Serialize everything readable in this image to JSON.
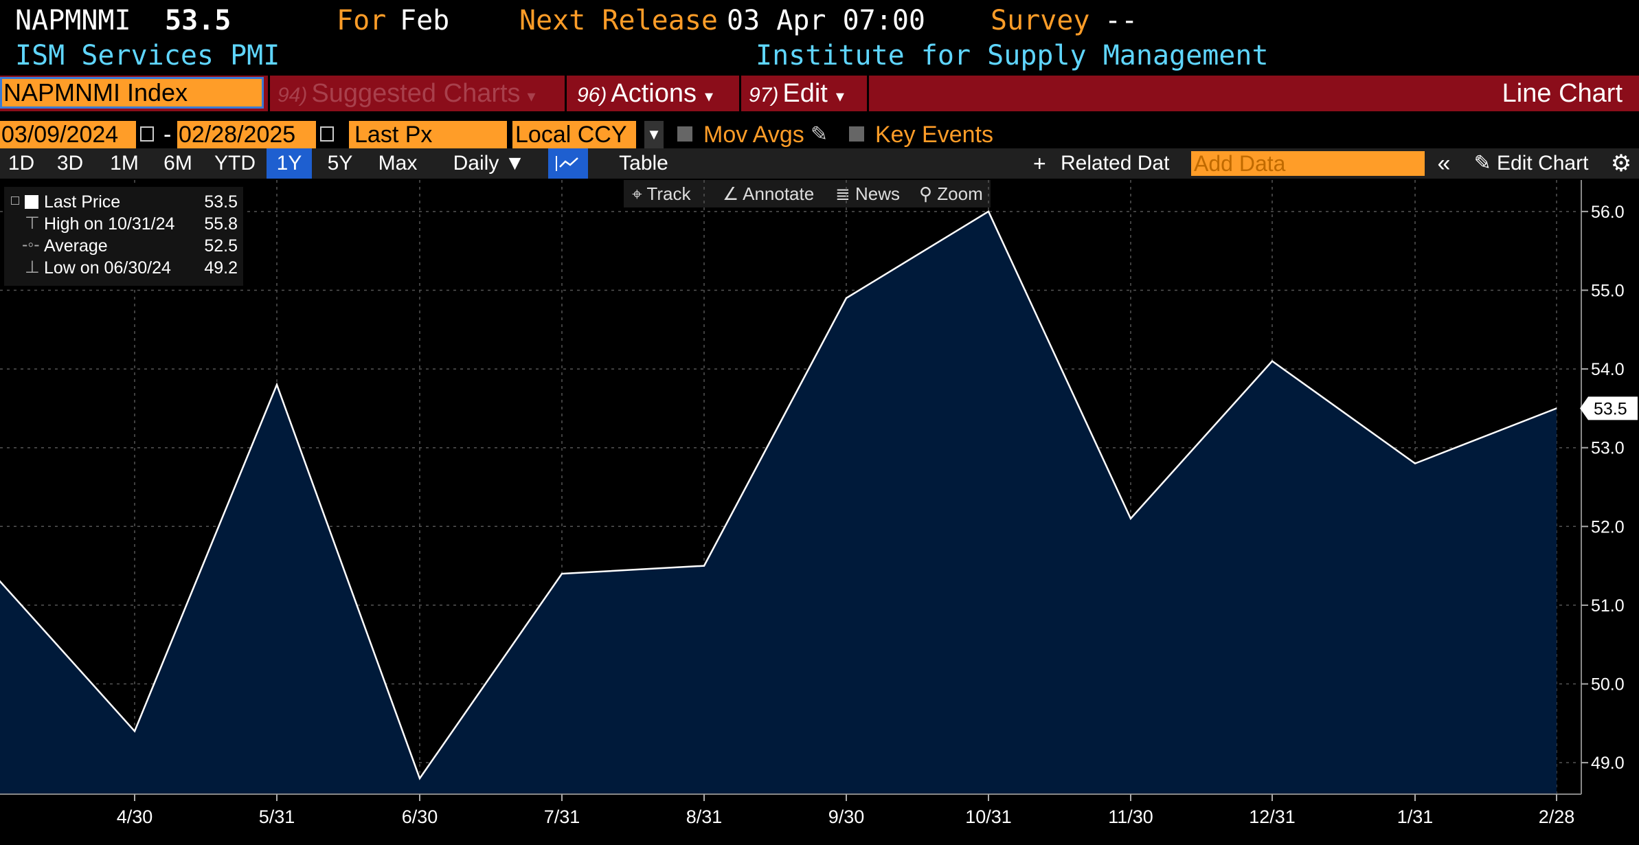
{
  "header": {
    "ticker": "NAPMNMI",
    "price": "53.5",
    "for_label": "For",
    "for_value": "Feb",
    "next_release_label": "Next Release",
    "next_release_value": "03 Apr 07:00",
    "survey_label": "Survey",
    "survey_value": "--",
    "name": "ISM Services PMI",
    "source": "Institute for Supply Management"
  },
  "toolbar": {
    "security": "NAPMNMI Index",
    "suggested_num": "94)",
    "suggested_label": "Suggested Charts",
    "actions_num": "96)",
    "actions_label": "Actions",
    "edit_num": "97)",
    "edit_label": "Edit",
    "chart_type": "Line Chart"
  },
  "controls": {
    "start_date": "03/09/2024",
    "dash": "-",
    "end_date": "02/28/2025",
    "field": "Last Px",
    "currency": "Local CCY",
    "mov_avgs": "Mov Avgs",
    "key_events": "Key Events"
  },
  "tabs": {
    "items": [
      "1D",
      "3D",
      "1M",
      "6M",
      "YTD",
      "1Y",
      "5Y",
      "Max"
    ],
    "active": "1Y",
    "frequency": "Daily ▼",
    "table": "Table",
    "related": "Related Dat",
    "add_data_placeholder": "Add Data",
    "edit_chart": "Edit Chart"
  },
  "tools": {
    "track": "Track",
    "annotate": "Annotate",
    "news": "News",
    "zoom": "Zoom"
  },
  "legend": {
    "last_label": "Last Price",
    "last_value": "53.5",
    "high_label": "High on 10/31/24",
    "high_value": "55.8",
    "avg_label": "Average",
    "avg_value": "52.5",
    "low_label": "Low on 06/30/24",
    "low_value": "49.2"
  },
  "chart_data": {
    "type": "area",
    "x": [
      "3/31",
      "4/30",
      "5/31",
      "6/30",
      "7/31",
      "8/31",
      "9/30",
      "10/31",
      "11/30",
      "12/31",
      "1/31",
      "2/28"
    ],
    "values": [
      51.4,
      49.4,
      53.8,
      48.8,
      51.4,
      51.5,
      54.9,
      56.0,
      52.1,
      54.1,
      52.8,
      53.5
    ],
    "x_tick_labels": [
      "4/30",
      "5/31",
      "6/30",
      "7/31",
      "8/31",
      "9/30",
      "10/31",
      "11/30",
      "12/31",
      "1/31",
      "2/28"
    ],
    "y_ticks": [
      49.0,
      50.0,
      51.0,
      52.0,
      53.0,
      54.0,
      55.0,
      56.0
    ],
    "ylim": [
      48.6,
      56.4
    ],
    "last_value_label": "53.5",
    "grid": true,
    "line_color": "#ffffff",
    "fill_color": "#001a3a"
  }
}
